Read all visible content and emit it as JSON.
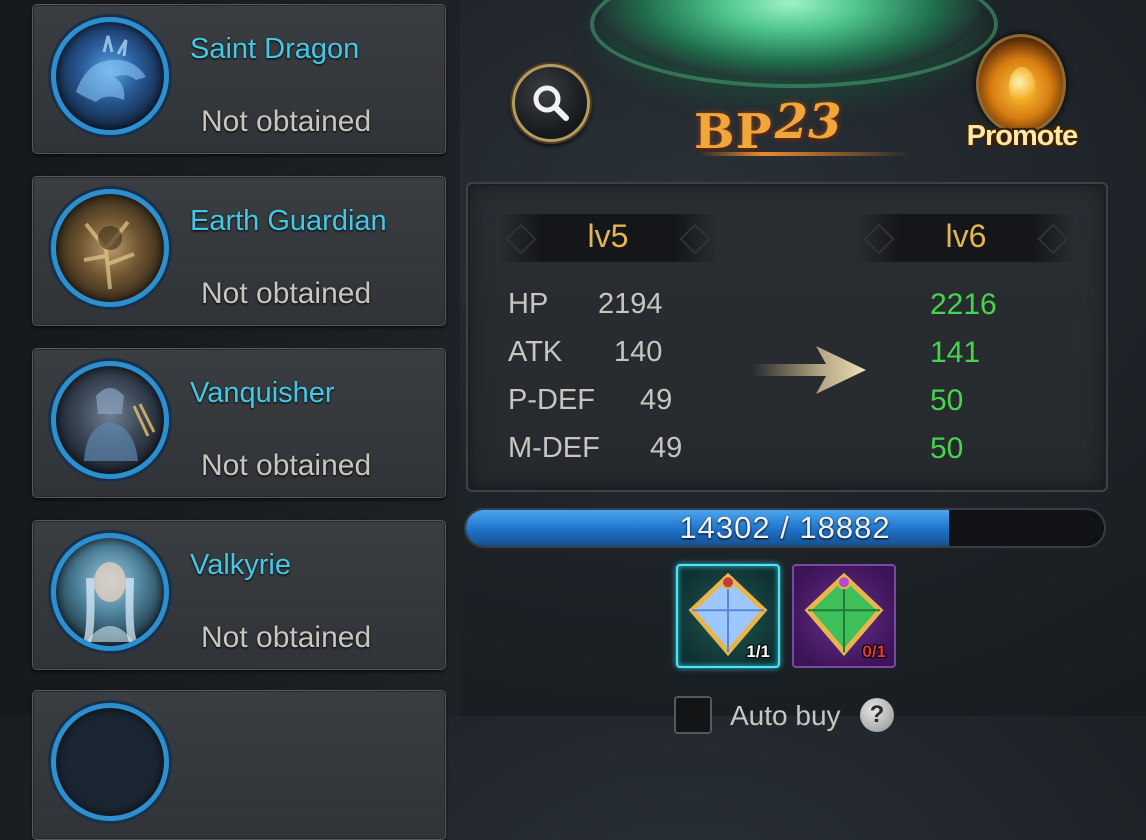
{
  "heroes": [
    {
      "name": "Saint Dragon",
      "status": "Not obtained"
    },
    {
      "name": "Earth Guardian",
      "status": "Not obtained"
    },
    {
      "name": "Vanquisher",
      "status": "Not obtained"
    },
    {
      "name": "Valkyrie",
      "status": "Not obtained"
    }
  ],
  "bp": {
    "label": "BP",
    "value": "23"
  },
  "promote": {
    "label": "Promote",
    "icon": "promote-egg-icon"
  },
  "search": {
    "icon": "search-icon"
  },
  "levels": {
    "current": "lv5",
    "next": "lv6"
  },
  "stats": [
    {
      "label": "HP",
      "current": "2194",
      "next": "2216"
    },
    {
      "label": "ATK",
      "current": "140",
      "next": "141"
    },
    {
      "label": "P-DEF",
      "current": "49",
      "next": "50"
    },
    {
      "label": "M-DEF",
      "current": "49",
      "next": "50"
    }
  ],
  "exp": {
    "text": "14302 / 18882",
    "fraction": 0.7575
  },
  "items": [
    {
      "icon": "blue-gem-chest-icon",
      "count": "1/1",
      "selected": true
    },
    {
      "icon": "green-gem-chest-icon",
      "count": "0/1",
      "selected": false
    }
  ],
  "auto_buy": {
    "label": "Auto buy",
    "checked": false,
    "help": "?"
  },
  "colors": {
    "hero_name": "#43c9e6",
    "level": "#e3b550",
    "stat_up": "#43d64b",
    "exp_fill": "#1f72c9",
    "insufficient": "#e23a3a"
  }
}
